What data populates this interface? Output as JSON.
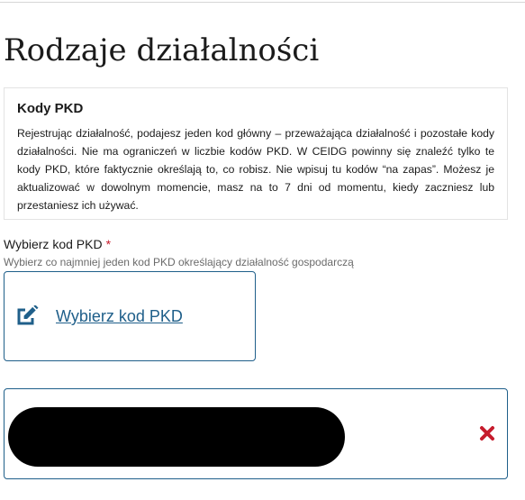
{
  "page": {
    "title": "Rodzaje działalności"
  },
  "info_box": {
    "title": "Kody PKD",
    "text": "Rejestrując działalność, podajesz jeden kod główny – przeważająca działalność i pozostałe kody działalności. Nie ma ograniczeń w liczbie kodów PKD. W CEIDG powinny się znaleźć tylko te kody PKD, które faktycznie określają to, co robisz. Nie wpisuj tu kodów “na zapas”. Możesz je aktualizować w dowolnym momencie, masz na to 7 dni od momentu, kiedy zaczniesz lub przestaniesz ich używać."
  },
  "pkd_field": {
    "label": "Wybierz kod PKD",
    "required_mark": "*",
    "hint": "Wybierz co najmniej jeden kod PKD określający działalność gospodarczą",
    "select_link": "Wybierz kod PKD",
    "link_icon": "edit-icon"
  },
  "selected_item": {
    "value_redacted": true,
    "remove_icon": "close-icon"
  },
  "colors": {
    "accent": "#1f5f8a",
    "required": "#c61b2c",
    "remove": "#c61b2c",
    "text": "#1b1b1b",
    "hint": "#6b6b6b",
    "redaction": "#000000"
  }
}
